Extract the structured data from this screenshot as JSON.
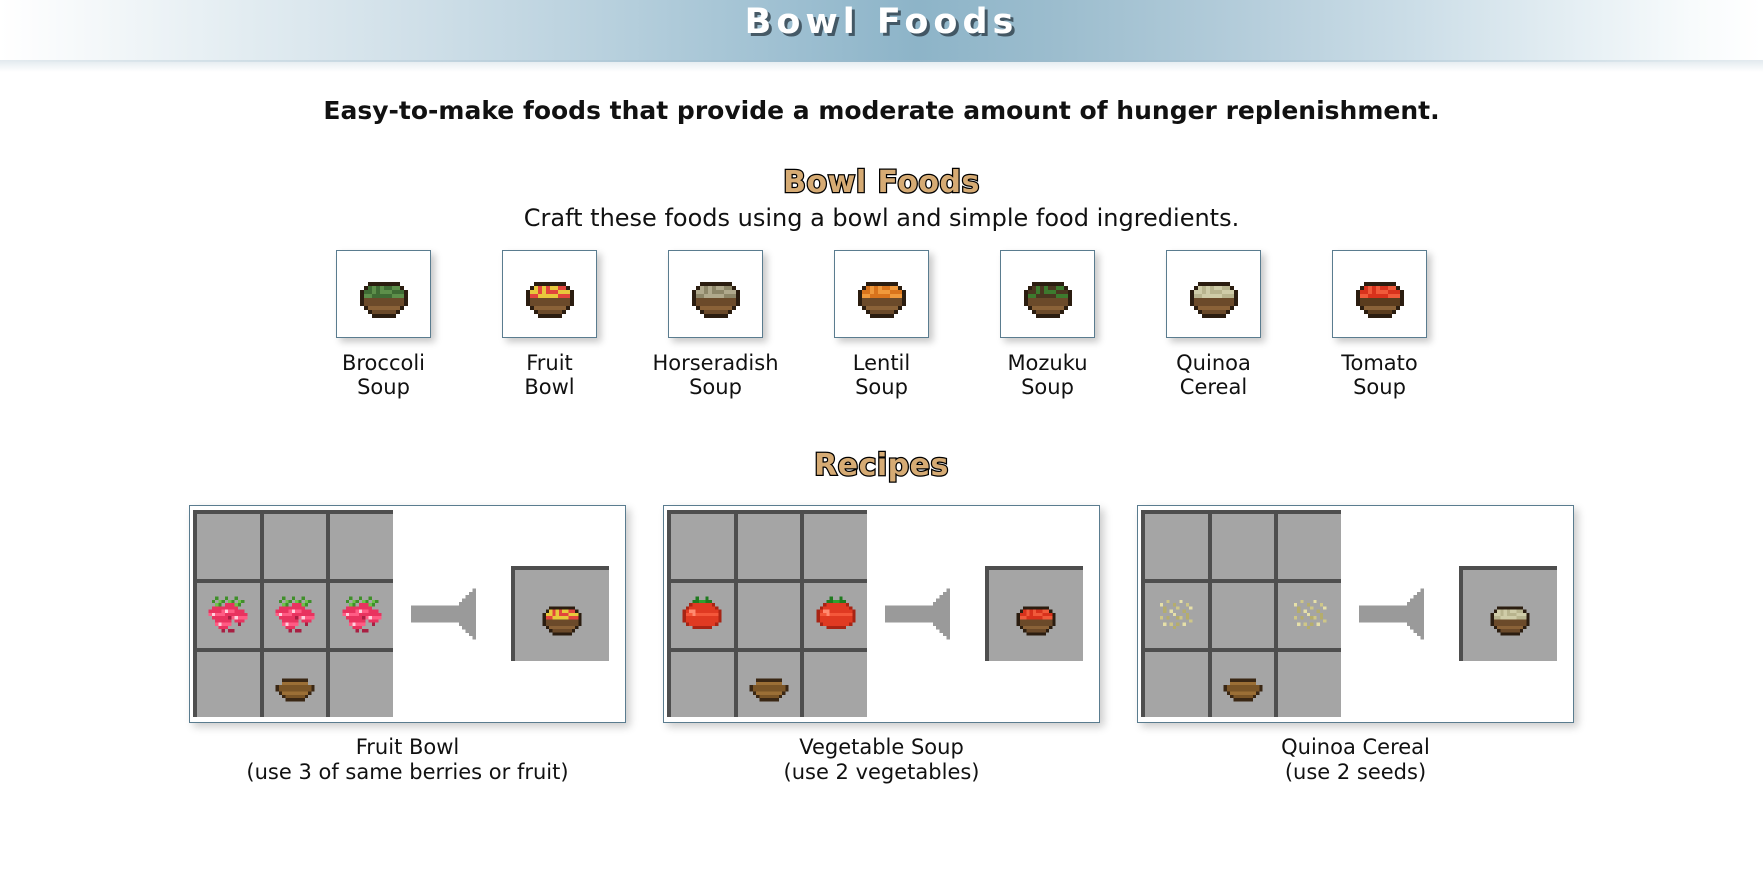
{
  "banner": {
    "title": "Bowl Foods"
  },
  "subtitle": "Easy-to-make foods that provide a moderate amount of hunger replenishment.",
  "sections": {
    "bowl_foods": {
      "heading": "Bowl Foods",
      "description": "Craft these foods using a bowl and simple food ingredients."
    },
    "recipes": {
      "heading": "Recipes"
    }
  },
  "items": [
    {
      "label": "Broccoli\nSoup",
      "icon": "broccoli-soup-icon",
      "fill": "#3f6b34",
      "speck": "#5d8f4a",
      "rim": "#6b4a2a"
    },
    {
      "label": "Fruit\nBowl",
      "icon": "fruit-bowl-icon",
      "fill": "#e8c83c",
      "speck": "#e2453c",
      "rim": "#6b4a2a"
    },
    {
      "label": "Horseradish\nSoup",
      "icon": "horseradish-soup-icon",
      "fill": "#b0a98c",
      "speck": "#8d8668",
      "rim": "#6b4a2a"
    },
    {
      "label": "Lentil\nSoup",
      "icon": "lentil-soup-icon",
      "fill": "#d9741c",
      "speck": "#f0993b",
      "rim": "#6b4a2a"
    },
    {
      "label": "Mozuku\nSoup",
      "icon": "mozuku-soup-icon",
      "fill": "#4a3620",
      "speck": "#3d7a2e",
      "rim": "#6b4a2a"
    },
    {
      "label": "Quinoa\nCereal",
      "icon": "quinoa-cereal-icon",
      "fill": "#cfcca8",
      "speck": "#b8b48e",
      "rim": "#6b4a2a"
    },
    {
      "label": "Tomato\nSoup",
      "icon": "tomato-soup-icon",
      "fill": "#d8321c",
      "speck": "#f05a3a",
      "rim": "#5a3c1e"
    }
  ],
  "recipes": [
    {
      "title": "Fruit Bowl",
      "note": "(use 3 of same berries or fruit)",
      "caption": "Fruit Bowl\n(use 3 of same berries or fruit)",
      "grid": [
        [
          "",
          "",
          ""
        ],
        [
          "berries",
          "berries",
          "berries"
        ],
        [
          "",
          "bowl",
          ""
        ]
      ],
      "result": "fruit-bowl-icon",
      "result_fill": "#e8c83c",
      "result_speck": "#e2453c",
      "arrow": "right-arrow-icon"
    },
    {
      "title": "Vegetable Soup",
      "note": "(use 2 vegetables)",
      "caption": "Vegetable Soup\n(use 2 vegetables)",
      "grid": [
        [
          "",
          "",
          ""
        ],
        [
          "tomato",
          "",
          "tomato"
        ],
        [
          "",
          "bowl",
          ""
        ]
      ],
      "result": "tomato-soup-icon",
      "result_fill": "#d8321c",
      "result_speck": "#f05a3a",
      "arrow": "right-arrow-icon"
    },
    {
      "title": "Quinoa Cereal",
      "note": "(use 2 seeds)",
      "caption": "Quinoa Cereal\n(use 2 seeds)",
      "grid": [
        [
          "",
          "",
          ""
        ],
        [
          "seeds",
          "",
          "seeds"
        ],
        [
          "",
          "bowl",
          ""
        ]
      ],
      "result": "quinoa-cereal-icon",
      "result_fill": "#cfcca8",
      "result_speck": "#b8b48e",
      "arrow": "right-arrow-icon"
    }
  ],
  "colors": {
    "banner_accent": "#8db4c8",
    "heading_tan": "#d6ab74",
    "heading_outline": "#000000",
    "tile_border": "#5a7c8f",
    "cell_fill": "#a5a5a5",
    "cell_shadow": "#4e4e4e",
    "arrow": "#9a9a9a",
    "text": "#111111"
  }
}
